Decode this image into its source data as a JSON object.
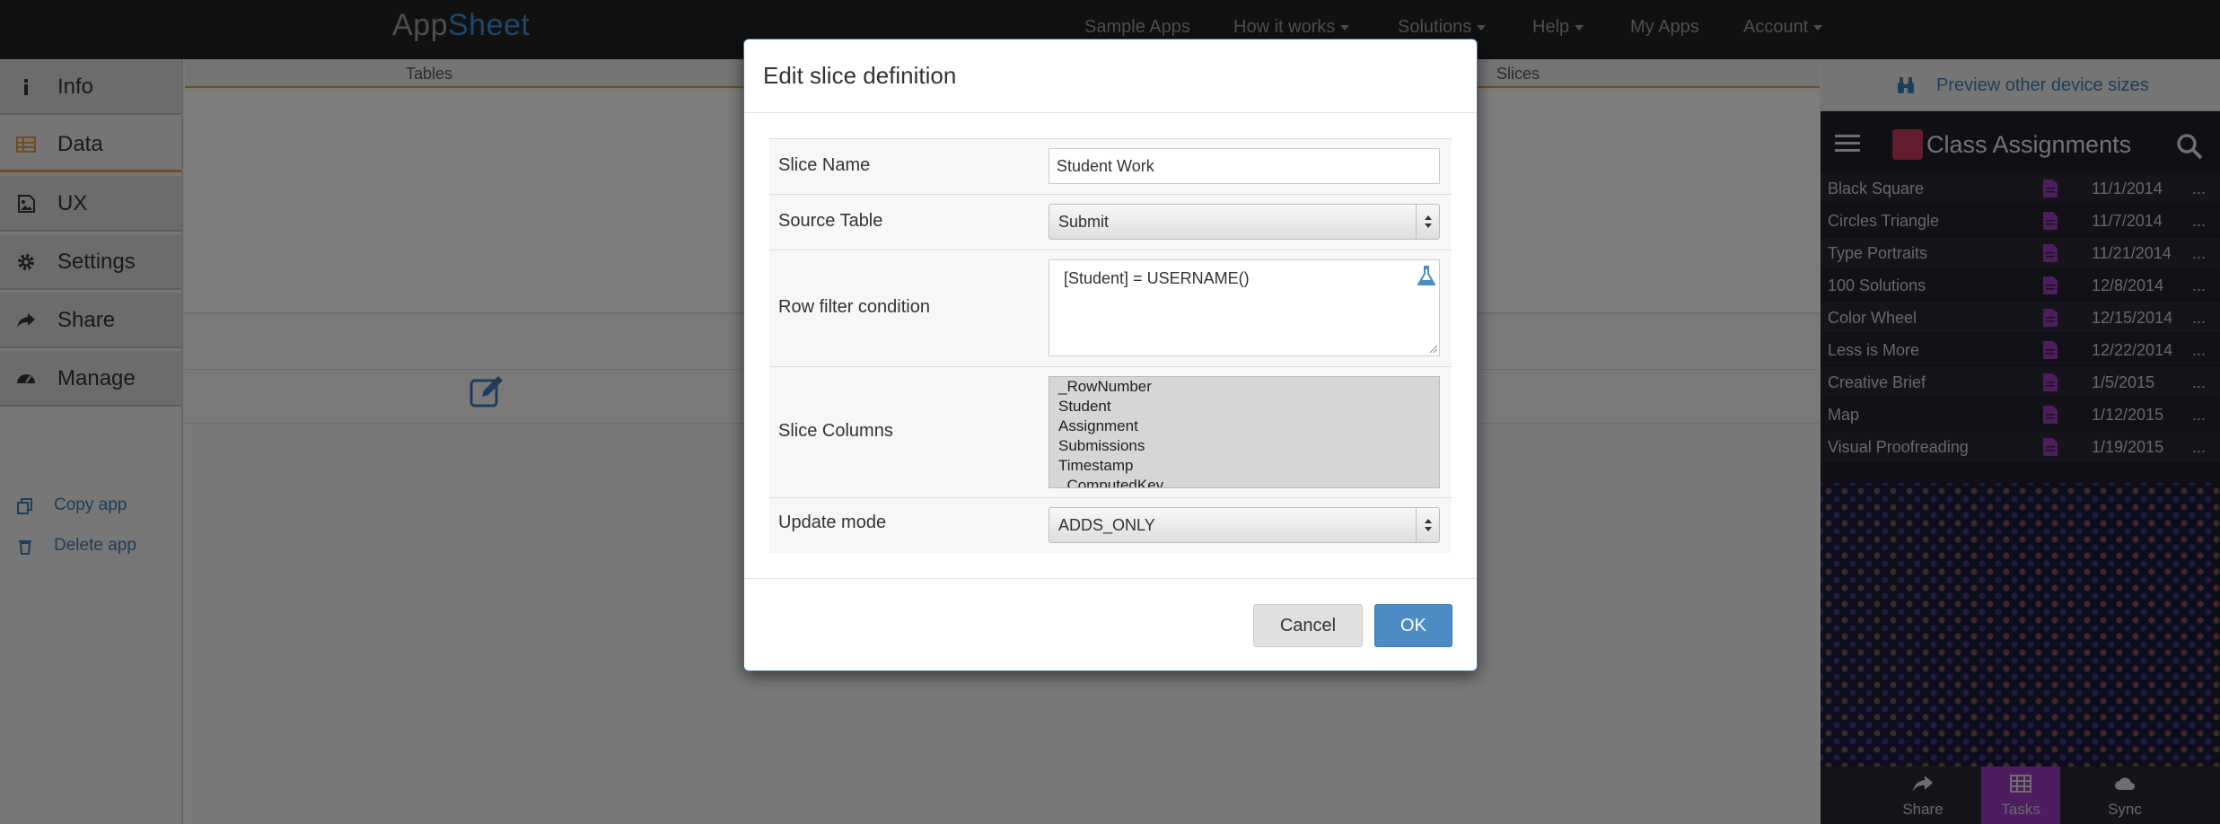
{
  "brand": {
    "part1": "App",
    "part2": "Sheet"
  },
  "nav": {
    "sample_apps": "Sample Apps",
    "how_it_works": "How it works",
    "solutions": "Solutions",
    "help": "Help",
    "my_apps": "My Apps",
    "account": "Account"
  },
  "sidebar": {
    "items": [
      {
        "label": "Info",
        "icon": "info-icon"
      },
      {
        "label": "Data",
        "icon": "table-icon"
      },
      {
        "label": "UX",
        "icon": "image-icon"
      },
      {
        "label": "Settings",
        "icon": "gear-icon"
      },
      {
        "label": "Share",
        "icon": "share-icon"
      },
      {
        "label": "Manage",
        "icon": "dashboard-icon"
      }
    ],
    "copy_app": "Copy app",
    "delete_app": "Delete app"
  },
  "main": {
    "tabs": {
      "tables": "Tables",
      "slices": "Slices"
    }
  },
  "modal": {
    "title": "Edit slice definition",
    "slice_name_label": "Slice Name",
    "slice_name_value": "Student Work",
    "source_table_label": "Source Table",
    "source_table_value": "Submit",
    "row_filter_label": "Row filter condition",
    "row_filter_value": "[Student]  = USERNAME()",
    "slice_columns_label": "Slice Columns",
    "slice_columns": [
      "_RowNumber",
      "Student",
      "Assignment",
      "Submissions",
      "Timestamp",
      "_ComputedKey"
    ],
    "update_mode_label": "Update mode",
    "update_mode_value": "ADDS_ONLY",
    "cancel": "Cancel",
    "ok": "OK"
  },
  "preview": {
    "device_sizes": "Preview other device sizes",
    "app_title": "Class Assignments",
    "rows": [
      {
        "name": "Black Square",
        "date": "11/1/2014"
      },
      {
        "name": "Circles Triangle",
        "date": "11/7/2014"
      },
      {
        "name": "Type Portraits",
        "date": "11/21/2014"
      },
      {
        "name": "100 Solutions",
        "date": "12/8/2014"
      },
      {
        "name": "Color Wheel",
        "date": "12/15/2014"
      },
      {
        "name": "Less is More",
        "date": "12/22/2014"
      },
      {
        "name": "Creative Brief",
        "date": "1/5/2015"
      },
      {
        "name": "Map",
        "date": "1/12/2015"
      },
      {
        "name": "Visual Proofreading",
        "date": "1/19/2015"
      }
    ],
    "more": "...",
    "bottom": {
      "share": "Share",
      "tasks": "Tasks",
      "sync": "Sync"
    }
  },
  "colors": {
    "accent_blue": "#4c8bc4",
    "tab_underline": "#e39b3b",
    "active_tab_purple": "#9b3bbf",
    "navbar": "#222222"
  }
}
